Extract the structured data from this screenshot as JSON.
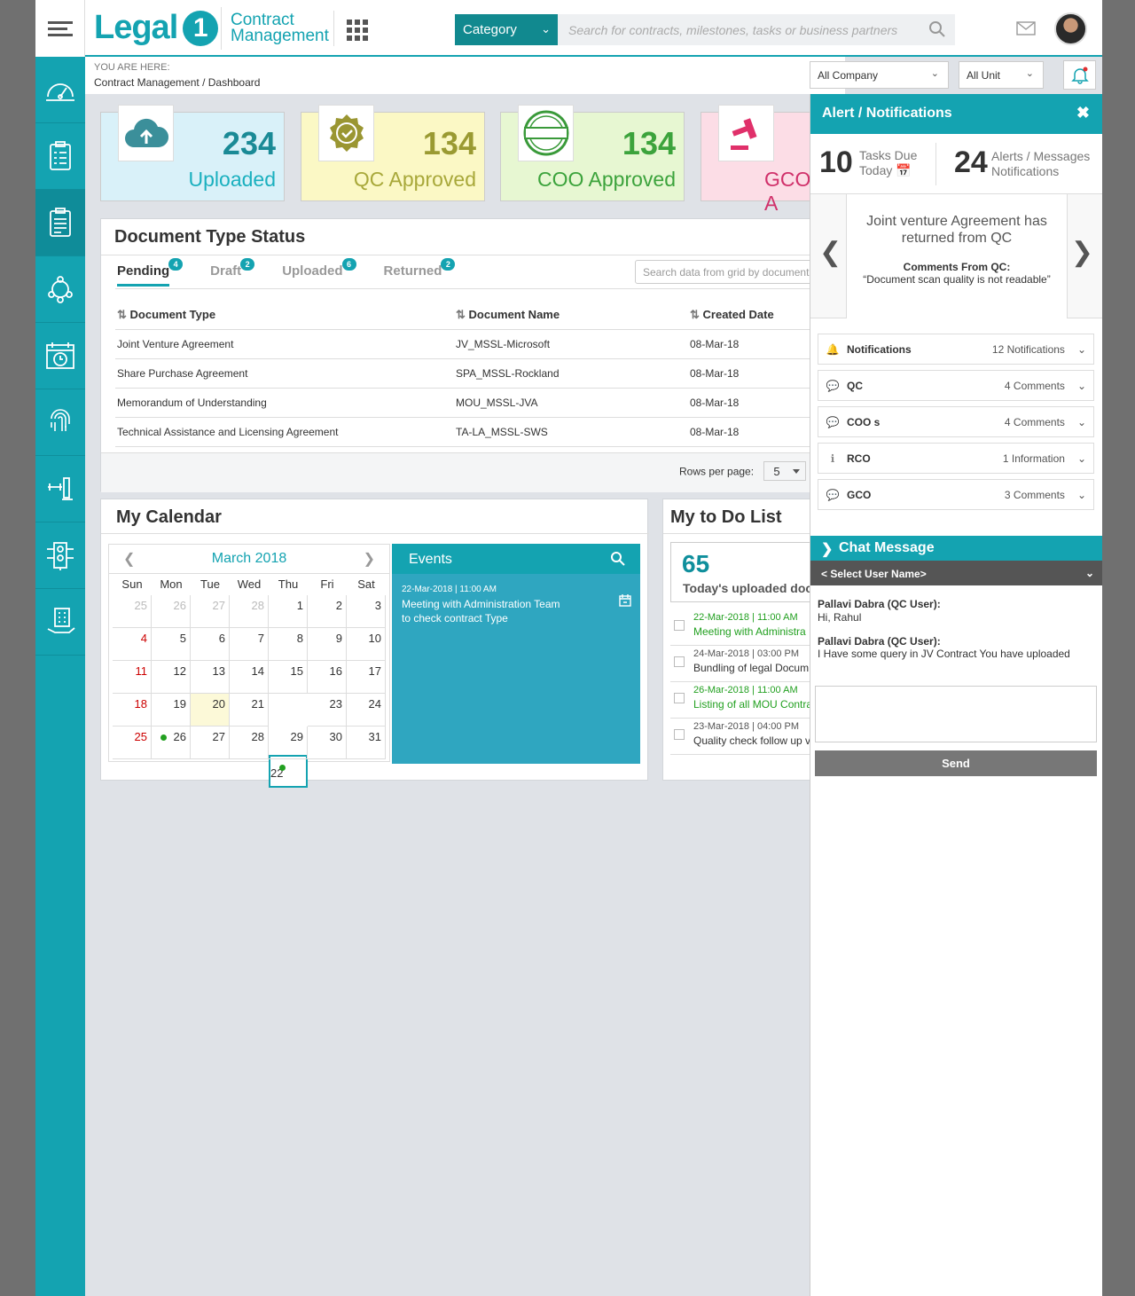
{
  "header": {
    "logo_text": "Legal",
    "logo_number": "1",
    "product_line1": "Contract",
    "product_line2": "Management",
    "category_label": "Category",
    "search_placeholder": "Search for contracts, milestones, tasks or business partners"
  },
  "breadcrumb": {
    "label": "YOU ARE HERE:",
    "path": "Contract Management / Dashboard"
  },
  "filters": {
    "company": "All Company",
    "unit": "All Unit"
  },
  "sidebar": {
    "items": [
      "dashboard-icon",
      "checklist-icon",
      "clipboard-icon",
      "network-icon",
      "calendar-clock-icon",
      "fingerprint-icon",
      "gavel-icon",
      "settings-list-icon",
      "building-hand-icon"
    ]
  },
  "stats": [
    {
      "value": "234",
      "label": "Uploaded",
      "color": "#1a8a96"
    },
    {
      "value": "134",
      "label": "QC Approved",
      "color": "#9a9a32"
    },
    {
      "value": "134",
      "label": "COO Approved",
      "color": "#3ca33c"
    },
    {
      "value": "",
      "label": "GCO A",
      "color": "#d0306a"
    }
  ],
  "doc_status": {
    "title": "Document Type Status",
    "tabs": [
      {
        "label": "Pending",
        "count": "4"
      },
      {
        "label": "Draft",
        "count": "2"
      },
      {
        "label": "Uploaded",
        "count": "6"
      },
      {
        "label": "Returned",
        "count": "2"
      }
    ],
    "grid_search_placeholder": "Search data from grid by document",
    "columns": [
      "Document Type",
      "Document Name",
      "Created Date"
    ],
    "rows": [
      [
        "Joint Venture Agreement",
        "JV_MSSL-Microsoft",
        "08-Mar-18"
      ],
      [
        "Share Purchase Agreement",
        "SPA_MSSL-Rockland",
        "08-Mar-18"
      ],
      [
        "Memorandum of Understanding",
        "MOU_MSSL-JVA",
        "08-Mar-18"
      ],
      [
        "Technical Assistance and Licensing Agreement",
        "TA-LA_MSSL-SWS",
        "08-Mar-18"
      ]
    ],
    "rows_per_page_label": "Rows per page:",
    "rows_per_page": "5"
  },
  "calendar": {
    "title": "My Calendar",
    "month": "March 2018",
    "weekdays": [
      "Sun",
      "Mon",
      "Tue",
      "Wed",
      "Thu",
      "Fri",
      "Sat"
    ],
    "weeks": [
      [
        "25",
        "26",
        "27",
        "28",
        "1",
        "2",
        "3"
      ],
      [
        "4",
        "5",
        "6",
        "7",
        "8",
        "9",
        "10"
      ],
      [
        "11",
        "12",
        "13",
        "14",
        "15",
        "16",
        "17"
      ],
      [
        "18",
        "19",
        "20",
        "21",
        "22",
        "23",
        "24"
      ],
      [
        "25",
        "26",
        "27",
        "28",
        "29",
        "30",
        "31"
      ]
    ],
    "events_label": "Events",
    "event_date": "22-Mar-2018 | 11:00 AM",
    "event_title": "Meeting with Administration Team to check contract Type"
  },
  "todo": {
    "title": "My to Do List",
    "count": "65",
    "count_label": "Today's uploaded docu",
    "items": [
      {
        "date": "22-Mar-2018 | 11:00 AM",
        "text": "Meeting with Administra",
        "highlight": true
      },
      {
        "date": "24-Mar-2018 | 03:00 PM",
        "text": "Bundling of legal Docum",
        "highlight": false
      },
      {
        "date": "26-Mar-2018 | 11:00 AM",
        "text": "Listing of all MOU Contra",
        "highlight": true
      },
      {
        "date": "23-Mar-2018 | 04:00 PM",
        "text": "Quality check follow up v",
        "highlight": false
      }
    ]
  },
  "alerts": {
    "title": "Alert / Notifications",
    "tasks_count": "10",
    "tasks_label1": "Tasks Due",
    "tasks_label2": "Today",
    "alerts_count": "24",
    "alerts_label1": "Alerts / Messages",
    "alerts_label2": "Notifications",
    "carousel_message": "Joint venture Agreement has returned from QC",
    "carousel_comment_label": "Comments From QC:",
    "carousel_comment": "“Document scan quality is not readable”",
    "accordion": [
      {
        "icon": "bell-icon",
        "label": "Notifications",
        "count": "12 Notifications"
      },
      {
        "icon": "comment-icon",
        "label": "QC",
        "count": "4 Comments"
      },
      {
        "icon": "comment-icon",
        "label": "COO s",
        "count": "4 Comments"
      },
      {
        "icon": "info-icon",
        "label": "RCO",
        "count": "1 Information"
      },
      {
        "icon": "comment-icon",
        "label": "GCO",
        "count": "3 Comments"
      }
    ]
  },
  "chat": {
    "title": "Chat Message",
    "select_user": "< Select User Name>",
    "messages": [
      {
        "from": "Pallavi Dabra (QC User):",
        "text": "Hi, Rahul"
      },
      {
        "from": "Pallavi Dabra  (QC User):",
        "text": "I Have some query in JV Contract You have uploaded"
      }
    ],
    "send_label": "Send"
  }
}
